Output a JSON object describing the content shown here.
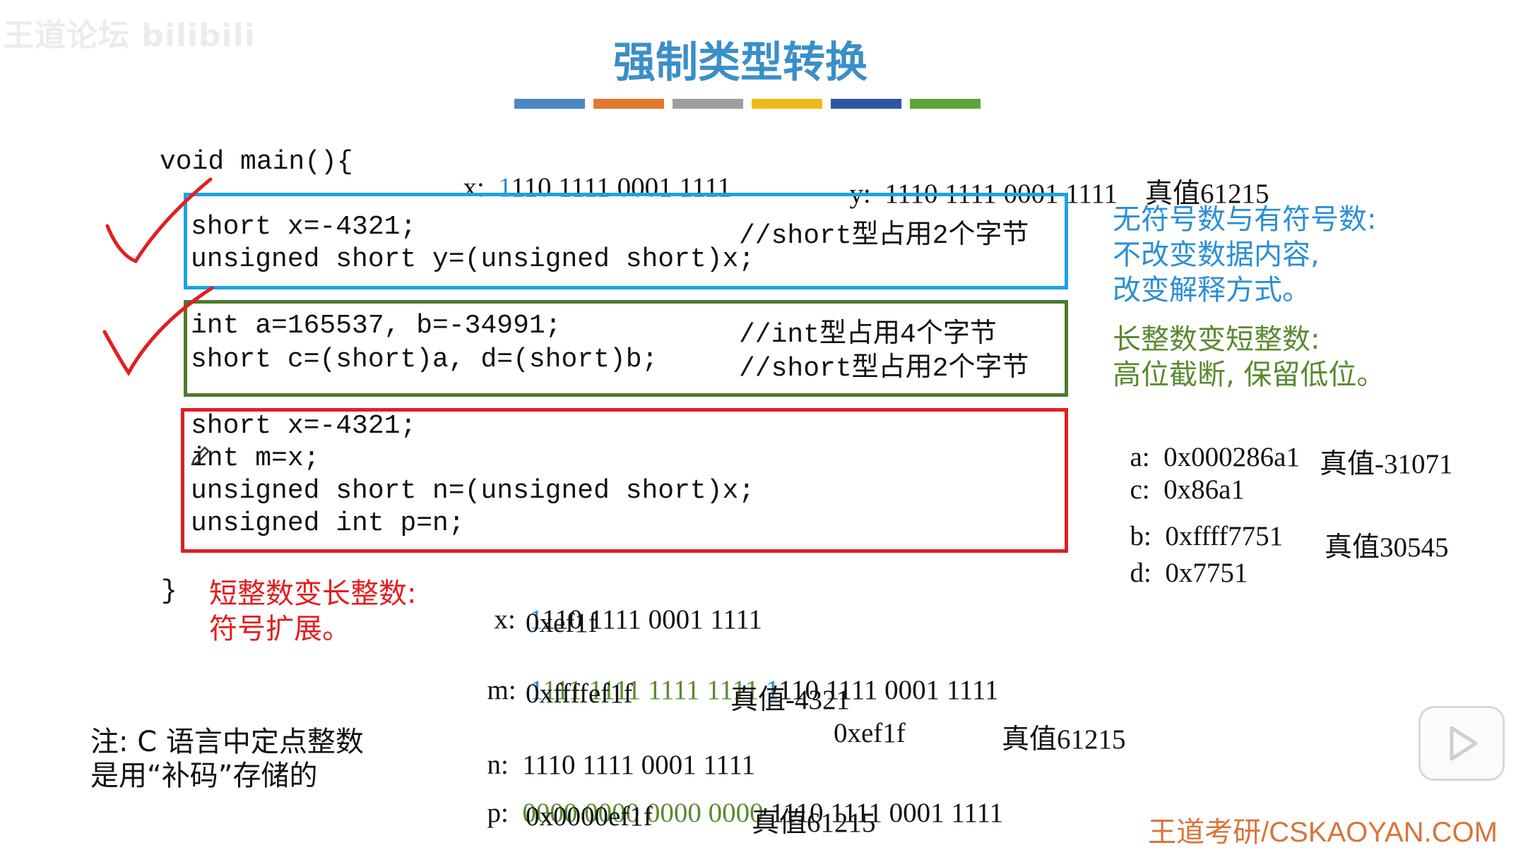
{
  "watermark": "王道论坛 bilibili",
  "title": "强制类型转换",
  "color_bar": [
    "#4a86c5",
    "#e0782f",
    "#9e9e9e",
    "#f2b81a",
    "#2f55a4",
    "#5fa33a"
  ],
  "code": {
    "header": "void main(){",
    "box1": [
      "short x=-4321;",
      "unsigned short y=(unsigned short)x;"
    ],
    "box1_comment": "//short型占用2个字节",
    "box2": [
      "int a=165537, b=-34991;",
      "short c=(short)a, d=(short)b;"
    ],
    "box2_comments": [
      "//int型占用4个字节",
      "//short型占用2个字节"
    ],
    "box3": [
      "short x=-4321;",
      "int m=x;",
      "unsigned short n=(unsigned short)x;",
      "unsigned int p=n;"
    ],
    "closing": "}"
  },
  "top_values": {
    "x_label": "x:",
    "x_first": "1",
    "x_rest": "110 1111 0001 1111",
    "y_label": "y:",
    "y_bits": "1110 1111 0001 1111",
    "y_true": "真值61215"
  },
  "side_notes": {
    "unsigned_vs_signed": [
      "无符号数与有符号数:",
      "不改变数据内容,",
      "改变解释方式。"
    ],
    "long_to_short": [
      "长整数变短整数:",
      "高位截断, 保留低位。"
    ],
    "short_to_long": [
      "短整数变长整数:",
      "符号扩展。"
    ],
    "complement": [
      "注: C 语言中定点整数",
      "是用“补码”存储的"
    ]
  },
  "hex_values": {
    "a": {
      "label": "a:",
      "hex": "0x000286a1"
    },
    "c": {
      "label": "c:",
      "hex": "0x86a1",
      "true": "真值-31071"
    },
    "b": {
      "label": "b:",
      "hex": "0xffff7751"
    },
    "d": {
      "label": "d:",
      "hex": "0x7751",
      "true": "真值30545"
    }
  },
  "bottom_values": {
    "x": {
      "label": "x:",
      "first": "1",
      "rest": "110 1111 0001 1111",
      "hex": "0xef1f"
    },
    "m": {
      "label": "m:",
      "ext_blue": "1",
      "ext_green": "111 1111 1111 1111 ",
      "orig_blue": "1",
      "rest": "110 1111 0001 1111",
      "hex": "0xffffef1f",
      "true": "真值-4321"
    },
    "n": {
      "label": "n:",
      "bits": "1110 1111 0001 1111",
      "hex": "0xef1f",
      "true": "真值61215"
    },
    "p": {
      "label": "p:",
      "ext": "0000 0000 0000 0000 ",
      "rest": "1110 1111 0001 1111",
      "hex": "0x0000ef1f",
      "true": "真值61215"
    }
  },
  "footer": "王道考研/CSKAOYAN.COM"
}
